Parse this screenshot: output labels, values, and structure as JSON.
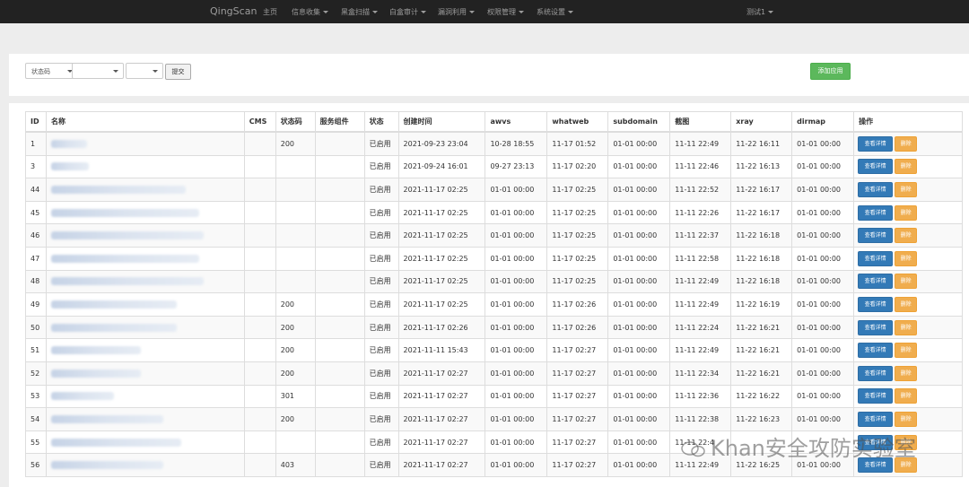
{
  "navbar": {
    "brand": "QingScan",
    "items": [
      {
        "label": "主页",
        "dropdown": false
      },
      {
        "label": "信息收集",
        "dropdown": true
      },
      {
        "label": "黑盒扫描",
        "dropdown": true
      },
      {
        "label": "白盒审计",
        "dropdown": true
      },
      {
        "label": "漏洞利用",
        "dropdown": true
      },
      {
        "label": "权限管理",
        "dropdown": true
      },
      {
        "label": "系统设置",
        "dropdown": true
      }
    ],
    "user": "测试1"
  },
  "filter": {
    "status_select": "状态码",
    "select2": "",
    "select3": "",
    "submit_label": "提交",
    "add_label": "添加应用"
  },
  "table": {
    "headers": [
      "ID",
      "名称",
      "CMS",
      "状态码",
      "服务组件",
      "状态",
      "创建时间",
      "awvs",
      "whatweb",
      "subdomain",
      "截图",
      "xray",
      "dirmap",
      "操作"
    ],
    "detail_label": "查看详情",
    "delete_label": "删除",
    "rows": [
      {
        "id": "1",
        "cms": "",
        "code": "200",
        "svc": "",
        "status": "已启用",
        "created": "2021-09-23 23:04",
        "awvs": "10-28 18:55",
        "whatweb": "11-17 01:52",
        "subdomain": "01-01 00:00",
        "shot": "11-11 22:49",
        "xray": "11-22 16:11",
        "dirmap": "01-01 00:00"
      },
      {
        "id": "3",
        "cms": "",
        "code": "",
        "svc": "",
        "status": "已启用",
        "created": "2021-09-24 16:01",
        "awvs": "09-27 23:13",
        "whatweb": "11-17 02:20",
        "subdomain": "01-01 00:00",
        "shot": "11-11 22:46",
        "xray": "11-22 16:13",
        "dirmap": "01-01 00:00"
      },
      {
        "id": "44",
        "cms": "",
        "code": "",
        "svc": "",
        "status": "已启用",
        "created": "2021-11-17 02:25",
        "awvs": "01-01 00:00",
        "whatweb": "11-17 02:25",
        "subdomain": "01-01 00:00",
        "shot": "11-11 22:52",
        "xray": "11-22 16:17",
        "dirmap": "01-01 00:00"
      },
      {
        "id": "45",
        "cms": "",
        "code": "",
        "svc": "",
        "status": "已启用",
        "created": "2021-11-17 02:25",
        "awvs": "01-01 00:00",
        "whatweb": "11-17 02:25",
        "subdomain": "01-01 00:00",
        "shot": "11-11 22:26",
        "xray": "11-22 16:17",
        "dirmap": "01-01 00:00"
      },
      {
        "id": "46",
        "cms": "",
        "code": "",
        "svc": "",
        "status": "已启用",
        "created": "2021-11-17 02:25",
        "awvs": "01-01 00:00",
        "whatweb": "11-17 02:25",
        "subdomain": "01-01 00:00",
        "shot": "11-11 22:37",
        "xray": "11-22 16:18",
        "dirmap": "01-01 00:00"
      },
      {
        "id": "47",
        "cms": "",
        "code": "",
        "svc": "",
        "status": "已启用",
        "created": "2021-11-17 02:25",
        "awvs": "01-01 00:00",
        "whatweb": "11-17 02:25",
        "subdomain": "01-01 00:00",
        "shot": "11-11 22:58",
        "xray": "11-22 16:18",
        "dirmap": "01-01 00:00"
      },
      {
        "id": "48",
        "cms": "",
        "code": "",
        "svc": "",
        "status": "已启用",
        "created": "2021-11-17 02:25",
        "awvs": "01-01 00:00",
        "whatweb": "11-17 02:25",
        "subdomain": "01-01 00:00",
        "shot": "11-11 22:49",
        "xray": "11-22 16:18",
        "dirmap": "01-01 00:00"
      },
      {
        "id": "49",
        "cms": "",
        "code": "200",
        "svc": "",
        "status": "已启用",
        "created": "2021-11-17 02:25",
        "awvs": "01-01 00:00",
        "whatweb": "11-17 02:26",
        "subdomain": "01-01 00:00",
        "shot": "11-11 22:49",
        "xray": "11-22 16:19",
        "dirmap": "01-01 00:00"
      },
      {
        "id": "50",
        "cms": "",
        "code": "200",
        "svc": "",
        "status": "已启用",
        "created": "2021-11-17 02:26",
        "awvs": "01-01 00:00",
        "whatweb": "11-17 02:26",
        "subdomain": "01-01 00:00",
        "shot": "11-11 22:24",
        "xray": "11-22 16:21",
        "dirmap": "01-01 00:00"
      },
      {
        "id": "51",
        "cms": "",
        "code": "200",
        "svc": "",
        "status": "已启用",
        "created": "2021-11-11 15:43",
        "awvs": "01-01 00:00",
        "whatweb": "11-17 02:27",
        "subdomain": "01-01 00:00",
        "shot": "11-11 22:49",
        "xray": "11-22 16:21",
        "dirmap": "01-01 00:00"
      },
      {
        "id": "52",
        "cms": "",
        "code": "200",
        "svc": "",
        "status": "已启用",
        "created": "2021-11-17 02:27",
        "awvs": "01-01 00:00",
        "whatweb": "11-17 02:27",
        "subdomain": "01-01 00:00",
        "shot": "11-11 22:34",
        "xray": "11-22 16:21",
        "dirmap": "01-01 00:00"
      },
      {
        "id": "53",
        "cms": "",
        "code": "301",
        "svc": "",
        "status": "已启用",
        "created": "2021-11-17 02:27",
        "awvs": "01-01 00:00",
        "whatweb": "11-17 02:27",
        "subdomain": "01-01 00:00",
        "shot": "11-11 22:36",
        "xray": "11-22 16:22",
        "dirmap": "01-01 00:00"
      },
      {
        "id": "54",
        "cms": "",
        "code": "200",
        "svc": "",
        "status": "已启用",
        "created": "2021-11-17 02:27",
        "awvs": "01-01 00:00",
        "whatweb": "11-17 02:27",
        "subdomain": "01-01 00:00",
        "shot": "11-11 22:38",
        "xray": "11-22 16:23",
        "dirmap": "01-01 00:00"
      },
      {
        "id": "55",
        "cms": "",
        "code": "",
        "svc": "",
        "status": "已启用",
        "created": "2021-11-17 02:27",
        "awvs": "01-01 00:00",
        "whatweb": "11-17 02:27",
        "subdomain": "01-01 00:00",
        "shot": "11-11 22:4",
        "xray": "",
        "dirmap": ""
      },
      {
        "id": "56",
        "cms": "",
        "code": "403",
        "svc": "",
        "status": "已启用",
        "created": "2021-11-17 02:27",
        "awvs": "01-01 00:00",
        "whatweb": "11-17 02:27",
        "subdomain": "01-01 00:00",
        "shot": "11-11 22:49",
        "xray": "11-22 16:25",
        "dirmap": "01-01 00:00"
      }
    ]
  },
  "watermark": "Khan安全攻防实验室"
}
